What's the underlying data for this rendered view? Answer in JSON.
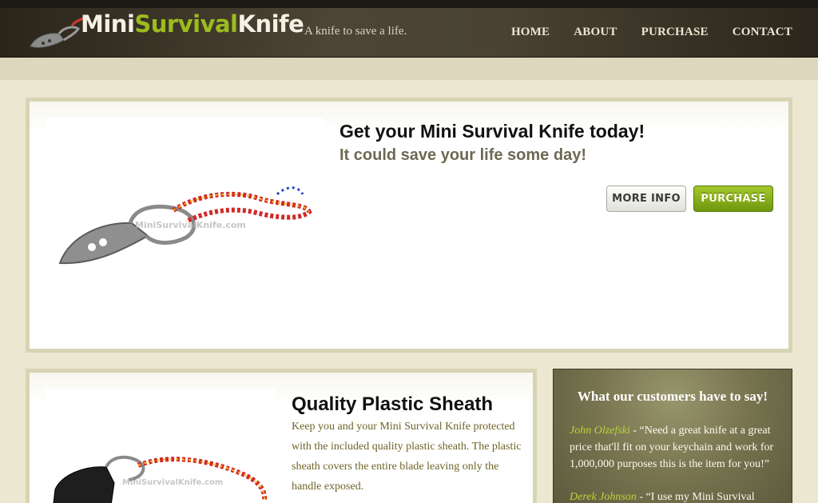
{
  "site": {
    "logo_part1": "Mini",
    "logo_part2": "Survival",
    "logo_part3": "Knife",
    "tagline": "A knife to save a life."
  },
  "nav": {
    "items": [
      "HOME",
      "ABOUT",
      "PURCHASE",
      "CONTACT"
    ]
  },
  "hero": {
    "title": "Get your Mini Survival Knife today!",
    "subtitle": "It could save your life some day!",
    "more_info_label": "MORE INFO",
    "purchase_label": "PURCHASE",
    "image_watermark": "MiniSurvivalKnife.com"
  },
  "sheath": {
    "title": "Quality Plastic Sheath",
    "text": "Keep you and your Mini Survival Knife protected with the included quality plastic sheath. The plastic sheath covers the entire blade leaving only the handle exposed.",
    "image_watermark": "MiniSurvivalKnife.com"
  },
  "testimonials": {
    "title": "What our customers have to say!",
    "items": [
      {
        "name": "John Olzefski",
        "quote": " - “Need a great knife at a great price that'll fit on your keychain and work for 1,000,000 purposes this is the item for you!”"
      },
      {
        "name": "Derek Johnson",
        "quote": " - “I use my Mini Survival"
      }
    ]
  },
  "colors": {
    "accent_green": "#9cbc1d",
    "header_dark": "#2a241a",
    "page_bg": "#ece7d1",
    "panel_border": "#d7d4b4"
  }
}
